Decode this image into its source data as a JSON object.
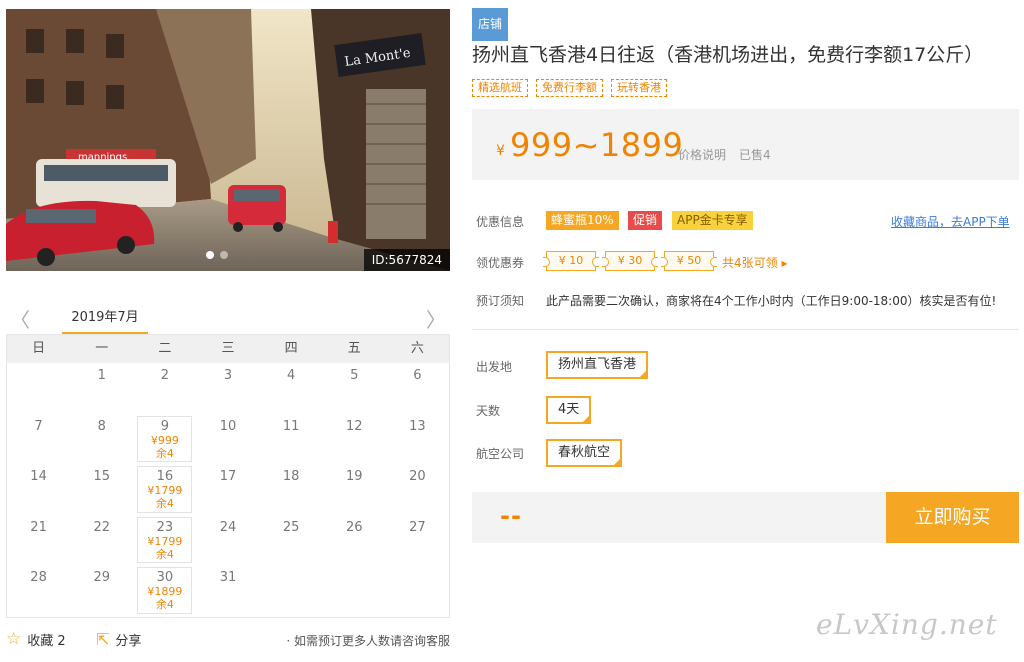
{
  "gallery": {
    "image_id": "ID:5677824",
    "sign_text": "La Mont'e",
    "banner_text": "mannings"
  },
  "calendar": {
    "month": "2019年7月",
    "prev": "〈",
    "next": "〉",
    "weekdays": [
      "日",
      "一",
      "二",
      "三",
      "四",
      "五",
      "六"
    ],
    "days": [
      {
        "d": ""
      },
      {
        "d": "1"
      },
      {
        "d": "2"
      },
      {
        "d": "3"
      },
      {
        "d": "4"
      },
      {
        "d": "5"
      },
      {
        "d": "6"
      },
      {
        "d": "7"
      },
      {
        "d": "8"
      },
      {
        "d": "9",
        "price": "¥999",
        "left": "余4"
      },
      {
        "d": "10"
      },
      {
        "d": "11"
      },
      {
        "d": "12"
      },
      {
        "d": "13"
      },
      {
        "d": "14"
      },
      {
        "d": "15"
      },
      {
        "d": "16",
        "price": "¥1799",
        "left": "余4"
      },
      {
        "d": "17"
      },
      {
        "d": "18"
      },
      {
        "d": "19"
      },
      {
        "d": "20"
      },
      {
        "d": "21"
      },
      {
        "d": "22"
      },
      {
        "d": "23",
        "price": "¥1799",
        "left": "余4"
      },
      {
        "d": "24"
      },
      {
        "d": "25"
      },
      {
        "d": "26"
      },
      {
        "d": "27"
      },
      {
        "d": "28"
      },
      {
        "d": "29"
      },
      {
        "d": "30",
        "price": "¥1899",
        "left": "余4"
      },
      {
        "d": "31"
      },
      {
        "d": ""
      },
      {
        "d": ""
      },
      {
        "d": ""
      }
    ]
  },
  "actions": {
    "favorite": "收藏 2",
    "share": "分享",
    "note": "· 如需预订更多人数请咨询客服"
  },
  "product": {
    "store_badge": "店铺",
    "title": "扬州直飞香港4日往返（香港机场进出，免费行李额17公斤）",
    "tags": [
      "精选航班",
      "免费行李额",
      "玩转香港"
    ],
    "price_currency": "¥",
    "price_range": "999~1899",
    "price_desc": "价格说明",
    "sold": "已售4"
  },
  "promotions": {
    "label": "优惠信息",
    "items": [
      "蜂蜜瓶10%",
      "促销",
      "APP金卡专享"
    ],
    "fav_link": "收藏商品，去APP下单"
  },
  "coupons": {
    "label": "领优惠券",
    "items": [
      "¥ 10",
      "¥ 30",
      "¥ 50"
    ],
    "more": "共4张可领 ▸"
  },
  "booking": {
    "label": "预订须知",
    "text": "此产品需要二次确认，商家将在4个工作小时内（工作日9:00-18:00）核实是否有位!"
  },
  "options": {
    "departure_label": "出发地",
    "departure": "扬州直飞香港",
    "days_label": "天数",
    "days": "4天",
    "airline_label": "航空公司",
    "airline": "春秋航空"
  },
  "purchase": {
    "total": "--",
    "buy_label": "立即购买"
  },
  "watermark": "eLvXing.net",
  "colors": {
    "accent": "#f5a623",
    "price": "#f08300",
    "link": "#3b7bd6",
    "promo_red": "#e84b4b",
    "badge_blue": "#5b9bd5"
  }
}
